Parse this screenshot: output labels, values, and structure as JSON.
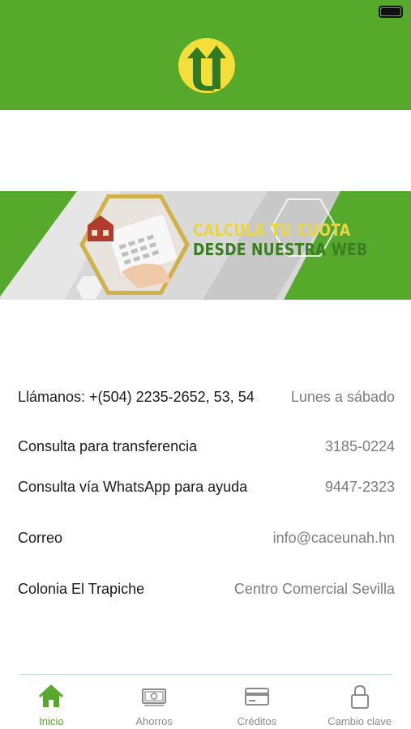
{
  "colors": {
    "brand_green": "#57a92b",
    "logo_yellow": "#f3de3a",
    "text_primary": "#1b1b1b",
    "text_secondary": "#7c7c7c"
  },
  "banner": {
    "line1": "CALCULA TU CUOTA",
    "line2": "DESDE NUESTRA WEB"
  },
  "contacts": [
    {
      "label": "Llámanos: +(504) 2235-2652, 53, 54",
      "value": "Lunes a sábado"
    },
    {
      "label": "Consulta para transferencia",
      "value": "3185-0224"
    },
    {
      "label": "Consulta vía WhatsApp para ayuda",
      "value": "9447-2323"
    },
    {
      "label": "Correo",
      "value": "info@caceunah.hn"
    },
    {
      "label": "Colonia El Trapiche",
      "value": "Centro Comercial Sevilla"
    }
  ],
  "tabs": [
    {
      "label": "Inicio",
      "icon": "home-icon",
      "active": true
    },
    {
      "label": "Ahorros",
      "icon": "money-icon",
      "active": false
    },
    {
      "label": "Créditos",
      "icon": "credit-card-icon",
      "active": false
    },
    {
      "label": "Cambio clave",
      "icon": "lock-icon",
      "active": false
    }
  ]
}
